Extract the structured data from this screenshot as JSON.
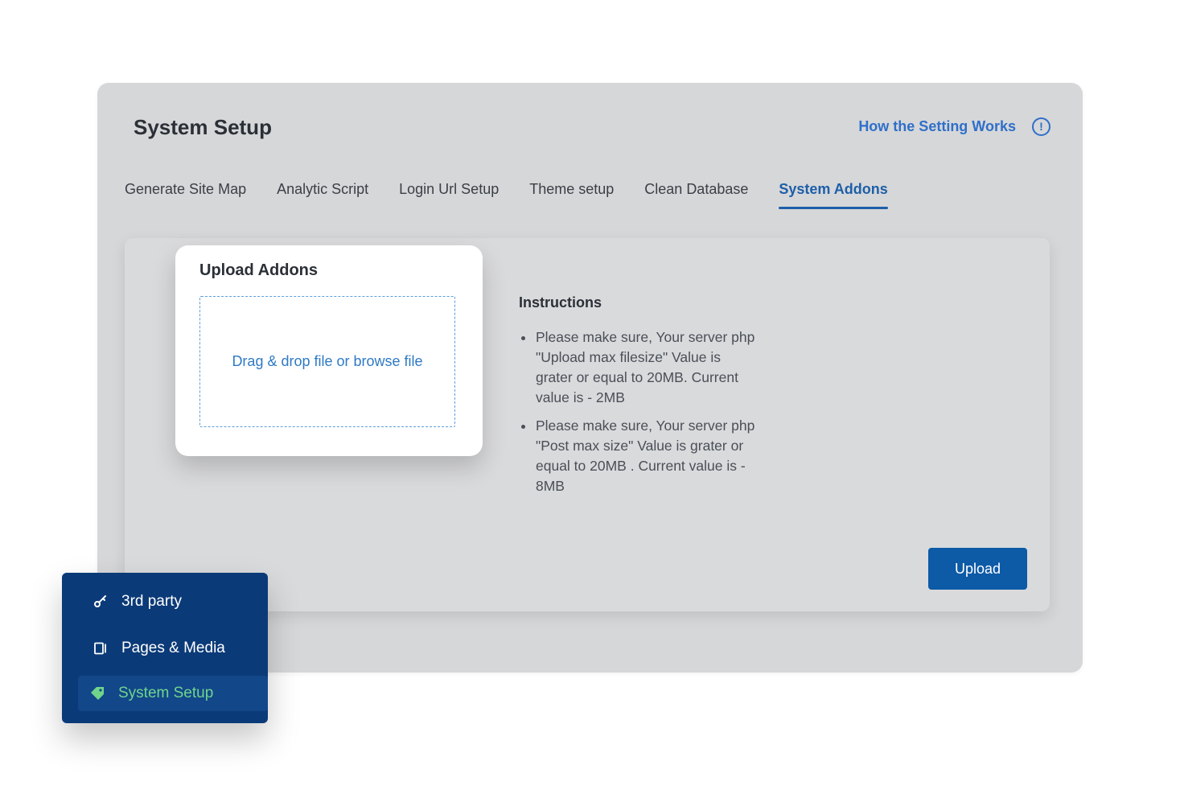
{
  "window": {
    "title": "System Setup",
    "help_link": "How the Setting Works",
    "help_icon": "info-icon"
  },
  "tabs": [
    {
      "label": "Generate Site Map",
      "active": false
    },
    {
      "label": "Analytic Script",
      "active": false
    },
    {
      "label": "Login Url Setup",
      "active": false
    },
    {
      "label": "Theme setup",
      "active": false
    },
    {
      "label": "Clean Database",
      "active": false
    },
    {
      "label": "System Addons",
      "active": true
    }
  ],
  "upload": {
    "title": "Upload Addons",
    "dropzone_text": "Drag & drop file or browse file",
    "button_label": "Upload"
  },
  "instructions": {
    "title": "Instructions",
    "items": [
      "Please make sure, Your server php \"Upload max filesize\" Value is grater or equal to 20MB. Current value is - 2MB",
      "Please make sure, Your server php \"Post max size\" Value is grater or equal to 20MB . Current value is - 8MB"
    ]
  },
  "sidebar": {
    "items": [
      {
        "label": "3rd party",
        "icon": "key-icon",
        "active": false
      },
      {
        "label": "Pages & Media",
        "icon": "pages-icon",
        "active": false
      },
      {
        "label": "System Setup",
        "icon": "tag-icon",
        "active": true
      }
    ]
  },
  "colors": {
    "accent": "#1d5fa8",
    "button": "#0d5aa7",
    "sidebar_bg": "#0b3a78",
    "sidebar_active_text": "#6fd58a",
    "link": "#2f6fc9"
  }
}
